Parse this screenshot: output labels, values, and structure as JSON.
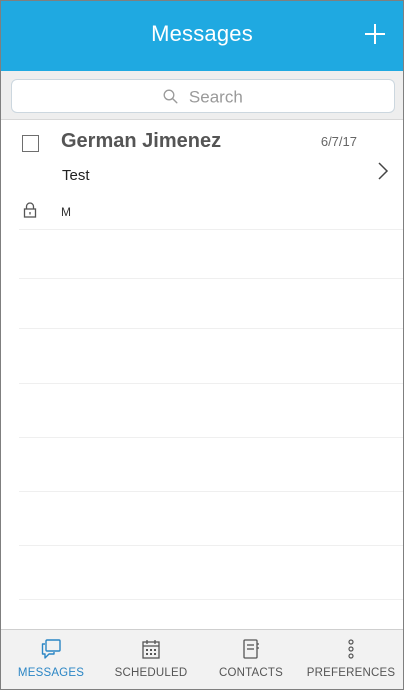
{
  "header": {
    "title": "Messages",
    "add_icon": "plus-icon"
  },
  "search": {
    "placeholder": "Search",
    "icon": "search-icon"
  },
  "messages": [
    {
      "sender": "German Jimenez",
      "date": "6/7/17",
      "subject": "Test",
      "preview": "M",
      "secure": true
    }
  ],
  "tabs": [
    {
      "label": "MESSAGES",
      "icon": "chat-bubble-icon",
      "active": true
    },
    {
      "label": "SCHEDULED",
      "icon": "calendar-icon",
      "active": false
    },
    {
      "label": "CONTACTS",
      "icon": "address-book-icon",
      "active": false
    },
    {
      "label": "PREFERENCES",
      "icon": "more-vertical-icon",
      "active": false
    }
  ],
  "colors": {
    "header_bg": "#1fa9e1",
    "active_tab": "#2b86c5",
    "tabbar_bg": "#f2f2f2",
    "search_bg": "#eeeeee"
  }
}
